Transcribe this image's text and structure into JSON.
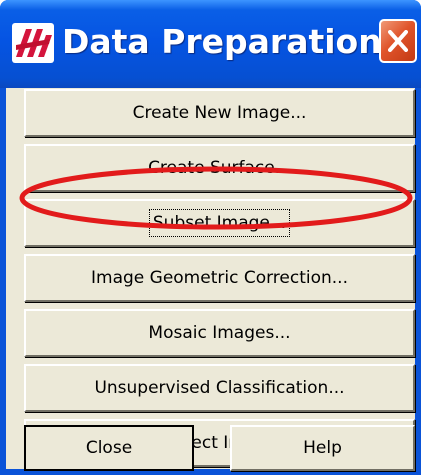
{
  "window": {
    "title": "Data Preparation",
    "app_icon": "erdas-logo-icon",
    "close_icon": "close-icon",
    "close_color": "#e0542b",
    "titlebar_color": "#0554e3"
  },
  "buttons": [
    {
      "label": "Create New Image..."
    },
    {
      "label": "Create Surface..."
    },
    {
      "label": "Subset Image...",
      "focused": true
    },
    {
      "label": "Image Geometric Correction..."
    },
    {
      "label": "Mosaic Images..."
    },
    {
      "label": "Unsupervised Classification..."
    },
    {
      "label": "Reproject Images..."
    }
  ],
  "footer": {
    "close_label": "Close",
    "help_label": "Help"
  },
  "annotation": {
    "color": "#e21b1b",
    "target": "Subset Image..."
  }
}
